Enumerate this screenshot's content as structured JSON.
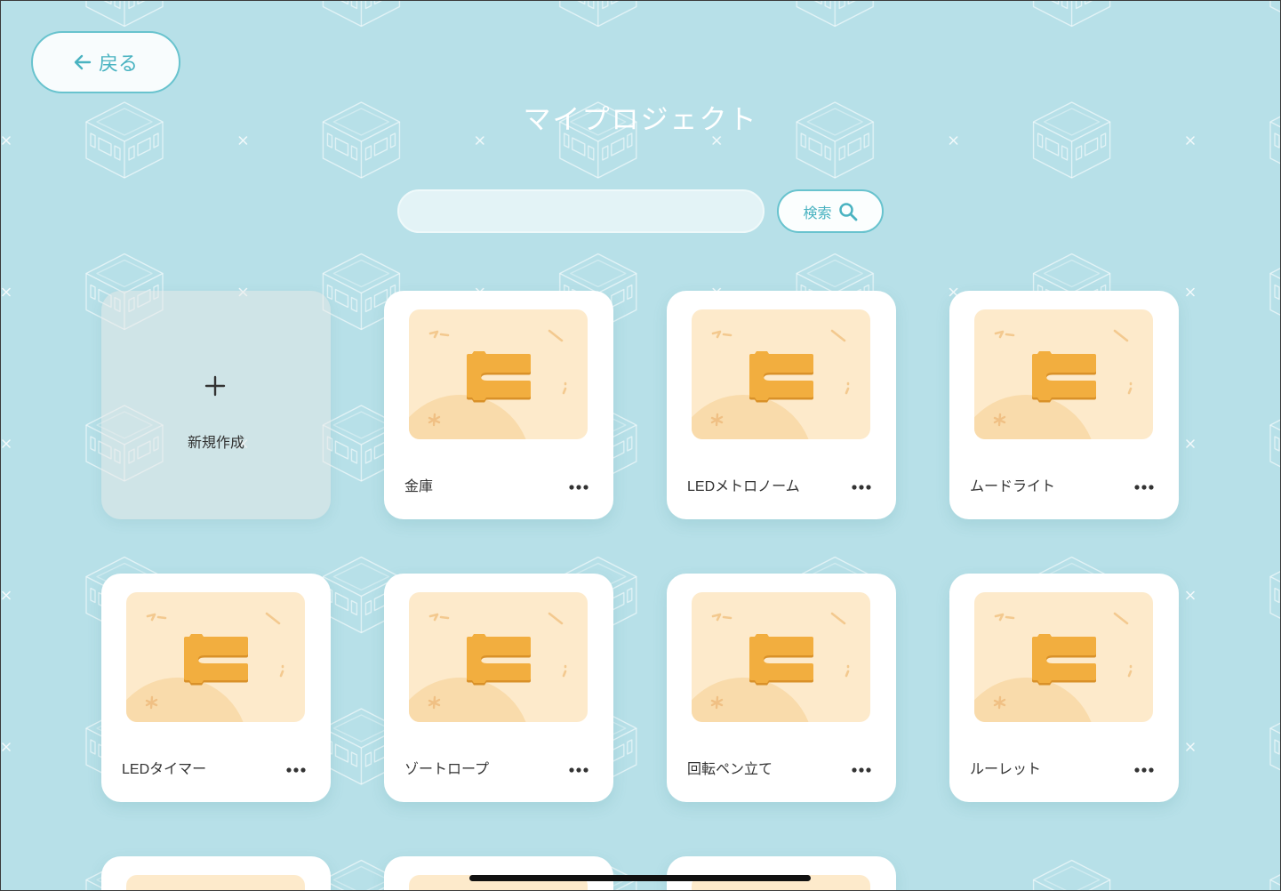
{
  "header": {
    "back_label": "戻る",
    "back_icon": "arrow-left-icon",
    "title": "マイプロジェクト"
  },
  "search": {
    "query": "",
    "button_label": "検索",
    "button_icon": "search-icon"
  },
  "new_project": {
    "label": "新規作成",
    "icon": "plus-icon"
  },
  "projects": [
    {
      "name": "金庫"
    },
    {
      "name": "LEDメトロノーム"
    },
    {
      "name": "ムードライト"
    },
    {
      "name": "LEDタイマー"
    },
    {
      "name": "ゾートロープ"
    },
    {
      "name": "回転ペン立て"
    },
    {
      "name": "ルーレット"
    }
  ],
  "project_thumbnail_icon": "code-block-icon",
  "project_menu_icon": "more-icon",
  "colors": {
    "background": "#b7e0e8",
    "accent": "#4ab3c1",
    "card": "#ffffff",
    "thumbnail": "#fdeacb",
    "block": "#f2ae3f"
  }
}
